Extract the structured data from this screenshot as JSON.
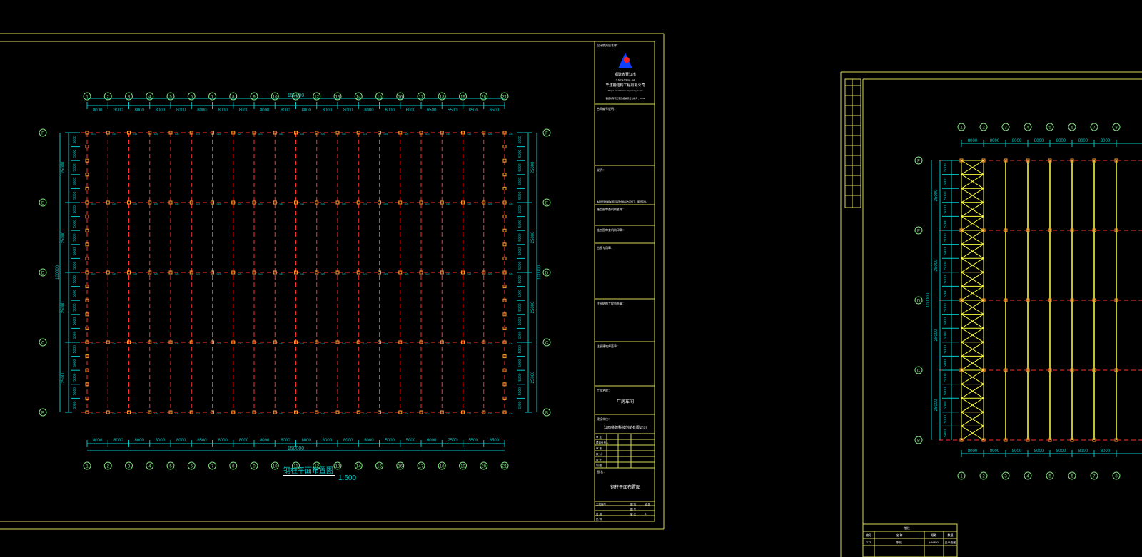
{
  "colors": {
    "background": "#000000",
    "frame": "#d9d95a",
    "grid_axis": "#ff3030",
    "dimension": "#00c8c8",
    "axis_bubble": "#7fe07f",
    "column": "#ff9a2a",
    "title_text": "#ffffff",
    "brace": "#ffff40"
  },
  "drawing1": {
    "axes_x": [
      "1",
      "2",
      "3",
      "4",
      "5",
      "6",
      "7",
      "8",
      "9",
      "10",
      "11",
      "12",
      "13",
      "14",
      "15",
      "16",
      "17",
      "18",
      "19",
      "20",
      "21"
    ],
    "bay_dims": [
      "8000",
      "3000",
      "8000",
      "8000",
      "8000",
      "8000",
      "8000",
      "8000",
      "8000",
      "8000",
      "8000",
      "8000",
      "8000",
      "8000",
      "6000",
      "6000",
      "6500",
      "5500",
      "8500",
      "6500"
    ],
    "bay_dims_bottom": [
      "8000",
      "8000",
      "8000",
      "8000",
      "8000",
      "8500",
      "8000",
      "8000",
      "8000",
      "8000",
      "8000",
      "8000",
      "8000",
      "8000",
      "5000",
      "5000",
      "6000",
      "7500",
      "5500",
      "6500"
    ],
    "total_x": "150000",
    "axes_y": [
      "F",
      "E",
      "D",
      "C",
      "B"
    ],
    "span_dims_left": [
      "25000",
      "25000",
      "25000",
      "25000"
    ],
    "span_dims_right": [
      "25000",
      "25000",
      "25000",
      "25000"
    ],
    "sub_dims": [
      "5000",
      "5000",
      "5000",
      "5000",
      "5000"
    ],
    "total_y": "100000",
    "plan_title": "钢柱平面布置图",
    "plan_scale": "1:600",
    "title_block": {
      "header_label": "设计院资质名称：",
      "company_line1": "福建省晋江市",
      "company_line2": "S.S.Y.E.T.S.Co.,Ltd",
      "company_line3": "华建钢结构工程有限公司",
      "company_line4": "Huajian Steel Structure Engineering Co.,Ltd",
      "cert_line": "钢结构专项工程乙级资质证书编号：A352",
      "project_label": "合同编号说明：",
      "note_label": "说明：",
      "note_text": "本图纸须经相关部门审查合格后方可施工，图纸有效。",
      "reviewer_label": "施工图审查机构名称：",
      "reviewer_stamp_label": "施工图审查机构印章：",
      "stamp_label": "出图专用章：",
      "reg_engineer_label": "注册结构工程师签章：",
      "reg_architect_label": "注册建筑师签章：",
      "project_name_label": "工程名称：",
      "project_name": "厂房车间",
      "client_label": "建设单位：",
      "client_name": "江西盛德科技创新有限公司",
      "sign_rows": [
        "审 定",
        "项目负责人",
        "审 核",
        "校 对",
        "设 计",
        "制 图"
      ],
      "drawing_name_label": "图 名：",
      "drawing_name": "钢柱平面布置图",
      "bottom_labels": [
        "工程编号",
        "图 别",
        "结 施",
        "图 号",
        "日 期",
        "比 例",
        "版 次",
        "A"
      ]
    }
  },
  "drawing2": {
    "axes_x": [
      "1",
      "2",
      "3",
      "4",
      "5",
      "6",
      "7",
      "8"
    ],
    "bay_dims": [
      "8000",
      "8000",
      "8000",
      "8000",
      "8000",
      "8000",
      "8000"
    ],
    "axes_y": [
      "F",
      "E",
      "D",
      "C",
      "B"
    ],
    "span_dims": [
      "25000",
      "25000",
      "25000",
      "25000"
    ],
    "sub_dims": [
      "5000",
      "5000",
      "5000",
      "5000",
      "5000"
    ],
    "total_y": "100000",
    "table_title": "钢柱",
    "table_headers": [
      "编号",
      "名 称",
      "规格",
      "数量"
    ],
    "table_row": [
      "GZ1",
      "钢柱",
      "HN350",
      "见平面图"
    ]
  }
}
